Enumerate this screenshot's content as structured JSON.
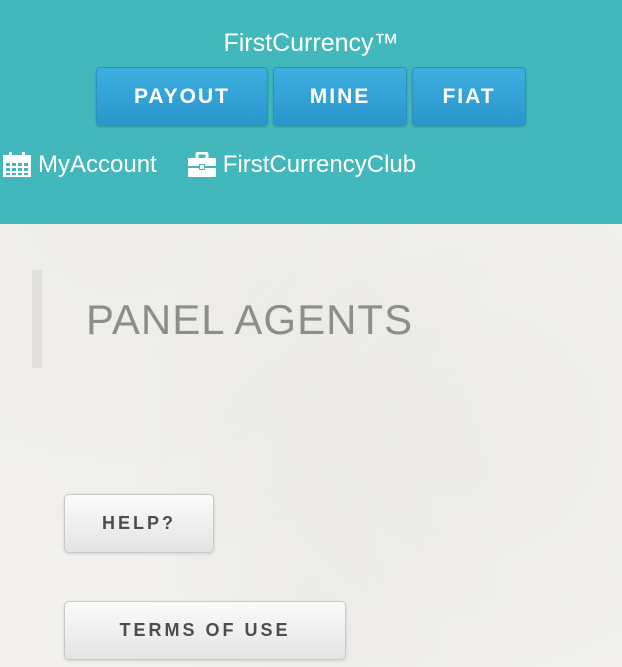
{
  "header": {
    "brand": "FirstCurrency™",
    "nav_buttons": [
      {
        "label": "PAYOUT"
      },
      {
        "label": "MINE"
      },
      {
        "label": "FIAT"
      }
    ],
    "links": [
      {
        "label": "MyAccount",
        "icon": "calendar-icon"
      },
      {
        "label": "FirstCurrencyClub",
        "icon": "briefcase-icon"
      }
    ],
    "background_color": "#43b8bc",
    "button_color": "#2e9fd6"
  },
  "main": {
    "title": "PANEL AGENTS",
    "help_label": "HELP?",
    "terms_label": "TERMS OF USE"
  }
}
